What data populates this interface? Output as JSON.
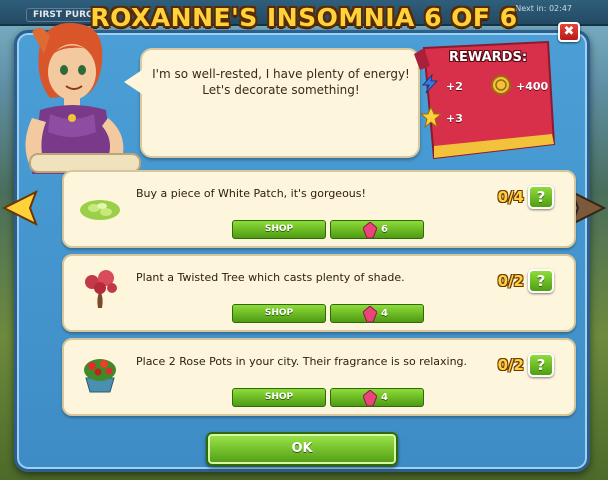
{
  "header": {
    "first_purchase": "FIRST PURCH",
    "next_in": "Next in: 02:47"
  },
  "dialog": {
    "title": "ROXANNE'S INSOMNIA 6 OF 6",
    "close_label": "✖",
    "message": "I'm so well-rested, I have plenty of energy! Let's decorate something!",
    "rewards": {
      "title": "REWARDS:",
      "items": [
        {
          "icon": "energy-bolt-icon",
          "value": "+2"
        },
        {
          "icon": "gold-coin-icon",
          "value": "+400"
        },
        {
          "icon": "star-icon",
          "value": "+3"
        }
      ]
    },
    "quests": [
      {
        "icon": "white-patch-icon",
        "text": "Buy a piece of White Patch, it's gorgeous!",
        "progress": "0/4",
        "shop_label": "SHOP",
        "cost": "6",
        "help": "?"
      },
      {
        "icon": "twisted-tree-icon",
        "text": "Plant a Twisted Tree which casts plenty of shade.",
        "progress": "0/2",
        "shop_label": "SHOP",
        "cost": "4",
        "help": "?"
      },
      {
        "icon": "rose-pot-icon",
        "text": "Place 2 Rose Pots in your city. Their fragrance is so relaxing.",
        "progress": "0/2",
        "shop_label": "SHOP",
        "cost": "4",
        "help": "?"
      }
    ],
    "ok_label": "OK"
  },
  "colors": {
    "panel": "#4b9fd6",
    "title": "#ffd23c",
    "rewards_ribbon": "#d8304a",
    "button_green": "#6fbf24"
  }
}
